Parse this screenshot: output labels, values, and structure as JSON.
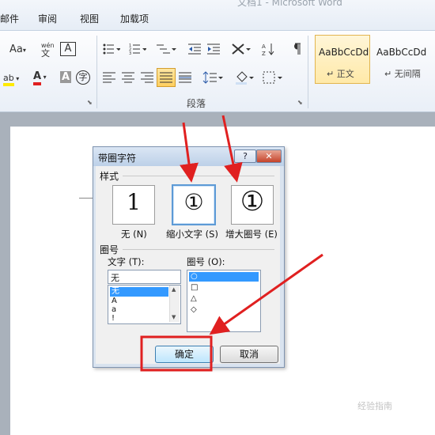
{
  "window": {
    "title": "文档1 - Microsoft Word"
  },
  "tabs": [
    "邮件",
    "审阅",
    "视图",
    "加载项"
  ],
  "ribbon": {
    "font_group": {
      "change_case": "Aa",
      "pinyin_label": "wén",
      "pinyin_char": "文",
      "char_border": "A",
      "highlight": "ab",
      "font_color": "A",
      "char_shade": "A",
      "enclose": "字"
    },
    "paragraph_group": {
      "label": "段落"
    },
    "styles": [
      {
        "sample": "AaBbCcDd",
        "name": "↵ 正文"
      },
      {
        "sample": "AaBbCcDd",
        "name": "↵ 无间隔"
      }
    ]
  },
  "dialog": {
    "title": "带圈字符",
    "help": "?",
    "close": "✕",
    "style_section": "样式",
    "style_options": [
      {
        "glyph": "1",
        "label": "无 (N)"
      },
      {
        "glyph": "①",
        "label": "缩小文字 (S)"
      },
      {
        "glyph": "①",
        "label": "增大圈号 (E)"
      }
    ],
    "enclosure_section": "圈号",
    "text_label": "文字 (T):",
    "text_value": "无",
    "text_list": [
      "无",
      "A",
      "a",
      "!"
    ],
    "enclosure_label": "圈号 (O):",
    "enclosure_list": [
      "○",
      "□",
      "△",
      "◇"
    ],
    "ok": "确定",
    "cancel": "取消"
  },
  "watermark": "经验指南"
}
